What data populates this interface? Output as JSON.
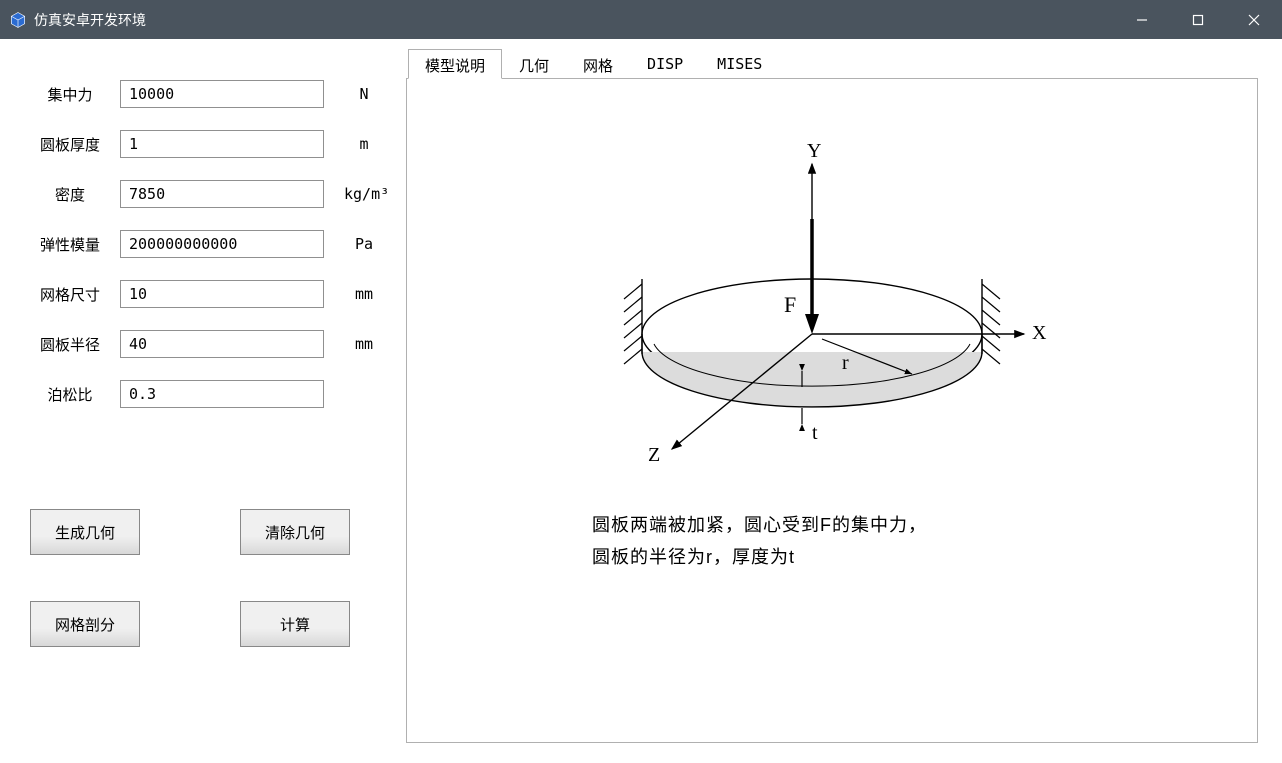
{
  "window": {
    "title": "仿真安卓开发环境"
  },
  "form": {
    "rows": [
      {
        "label": "集中力",
        "value": "10000",
        "unit": "N"
      },
      {
        "label": "圆板厚度",
        "value": "1",
        "unit": "m"
      },
      {
        "label": "密度",
        "value": "7850",
        "unit": "kg/m³"
      },
      {
        "label": "弹性模量",
        "value": "200000000000",
        "unit": "Pa"
      },
      {
        "label": "网格尺寸",
        "value": "10",
        "unit": "mm"
      },
      {
        "label": "圆板半径",
        "value": "40",
        "unit": "mm"
      },
      {
        "label": "泊松比",
        "value": "0.3",
        "unit": ""
      }
    ]
  },
  "buttons": {
    "generate_geometry": "生成几何",
    "clear_geometry": "清除几何",
    "mesh": "网格剖分",
    "compute": "计算"
  },
  "tabs": {
    "items": [
      {
        "id": "model-desc",
        "label": "模型说明",
        "active": true
      },
      {
        "id": "geometry",
        "label": "几何",
        "active": false
      },
      {
        "id": "mesh",
        "label": "网格",
        "active": false
      },
      {
        "id": "disp",
        "label": "DISP",
        "active": false
      },
      {
        "id": "mises",
        "label": "MISES",
        "active": false
      }
    ]
  },
  "diagram": {
    "labels": {
      "x": "X",
      "y": "Y",
      "z": "Z",
      "force": "F",
      "radius": "r",
      "thickness": "t"
    },
    "caption_line1": "圆板两端被加紧，圆心受到F的集中力，",
    "caption_line2": "圆板的半径为r，厚度为t"
  }
}
